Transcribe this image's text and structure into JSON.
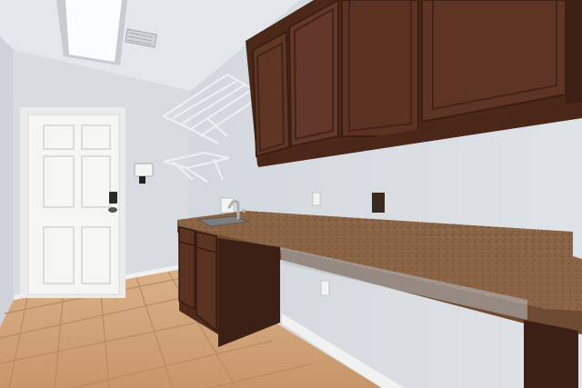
{
  "scene": {
    "subject": "laundry-room",
    "colors": {
      "wall": "#d7dbe0",
      "wall_shadow": "#c3c8ce",
      "ceiling": "#e4e7ea",
      "door": "#f4f4f2",
      "cabinet": "#5a3222",
      "cabinet_dark": "#3d2015",
      "countertop": "#8a6446",
      "floor_tile": "#d4a77a",
      "floor_grout": "#b88a60",
      "baseboard": "#f2f2f0",
      "shelf": "#eef0f2"
    },
    "icons": [
      "skylight",
      "air-vent",
      "wire-shelf",
      "wire-shelf",
      "thermostat",
      "faucet",
      "sink",
      "outlet",
      "outlet"
    ]
  }
}
